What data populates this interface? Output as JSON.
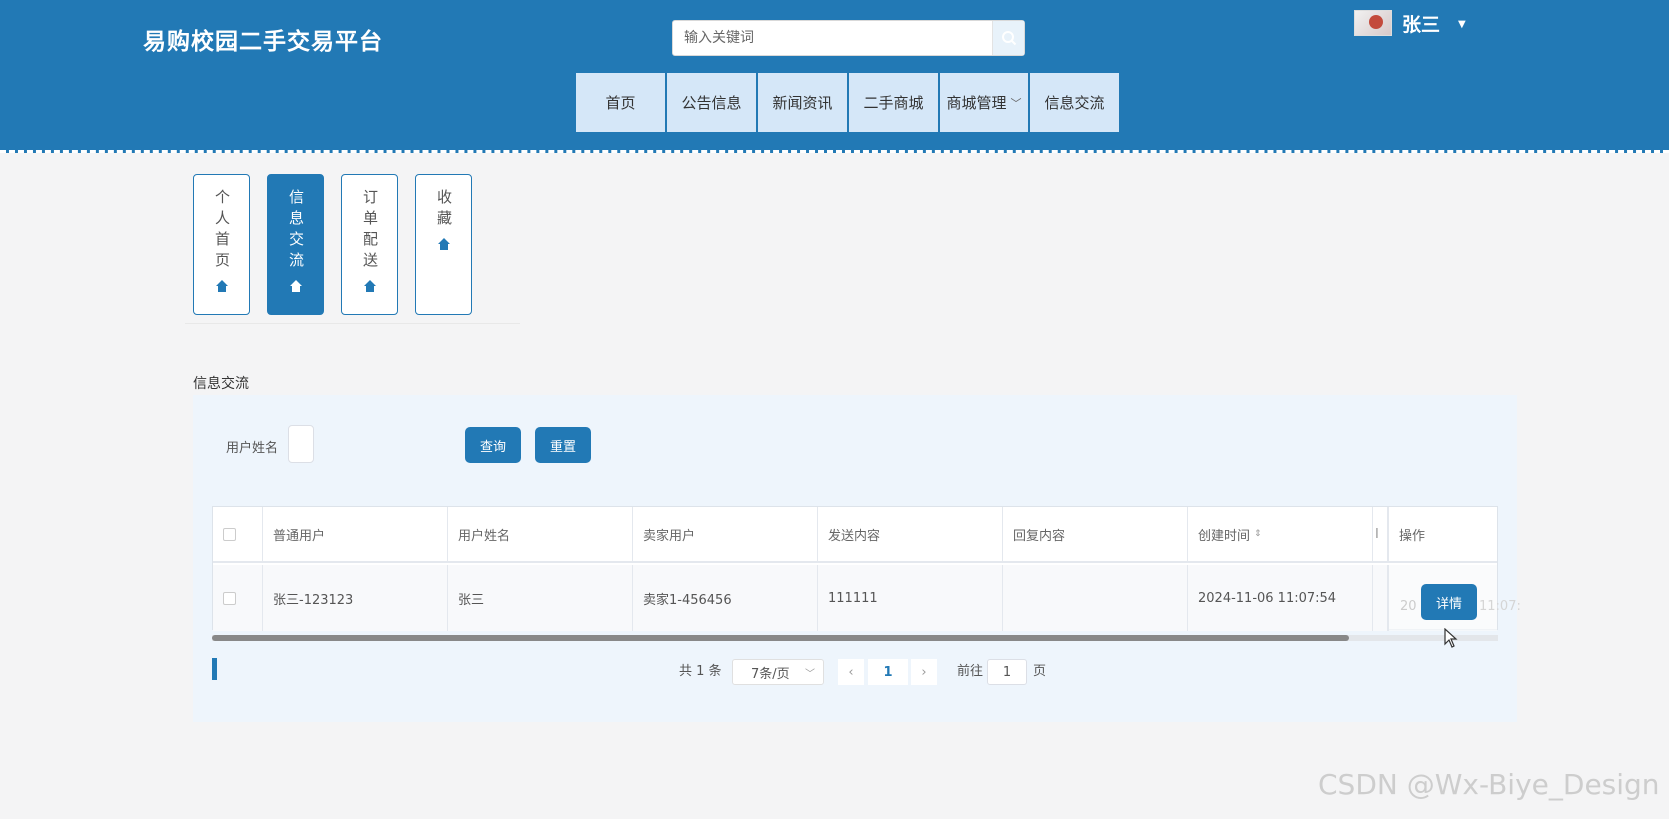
{
  "header": {
    "site_title": "易购校园二手交易平台",
    "search_placeholder": "输入关键词",
    "username": "张三"
  },
  "nav": {
    "items": [
      {
        "label": "首页"
      },
      {
        "label": "公告信息"
      },
      {
        "label": "新闻资讯"
      },
      {
        "label": "二手商城"
      },
      {
        "label": "商城管理",
        "has_dropdown": true
      },
      {
        "label": "信息交流"
      }
    ]
  },
  "tabs": [
    {
      "label": "个人首页",
      "active": false
    },
    {
      "label": "信息交流",
      "active": true
    },
    {
      "label": "订单配送",
      "active": false
    },
    {
      "label": "收藏",
      "active": false
    }
  ],
  "section": {
    "title": "信息交流",
    "filter_label": "用户姓名",
    "query_button": "查询",
    "reset_button": "重置"
  },
  "table": {
    "columns": [
      "普通用户",
      "用户姓名",
      "卖家用户",
      "发送内容",
      "回复内容",
      "创建时间",
      "操作"
    ],
    "rows": [
      {
        "user": "张三-123123",
        "name": "张三",
        "seller": "卖家1-456456",
        "content": "111111",
        "reply": "",
        "created": "2024-11-06 11:07:54",
        "overflow_left": "20",
        "overflow_right": "11:07:",
        "action": "详情"
      }
    ]
  },
  "pagination": {
    "total": "共 1 条",
    "page_size": "7条/页",
    "current_page": "1",
    "goto_label": "前往",
    "goto_value": "1",
    "page_suffix": "页"
  },
  "watermark": "CSDN @Wx-Biye_Design",
  "colors": {
    "primary": "#2279b5",
    "nav_bg": "#d5e7f8",
    "panel_bg": "#eef5fc"
  }
}
